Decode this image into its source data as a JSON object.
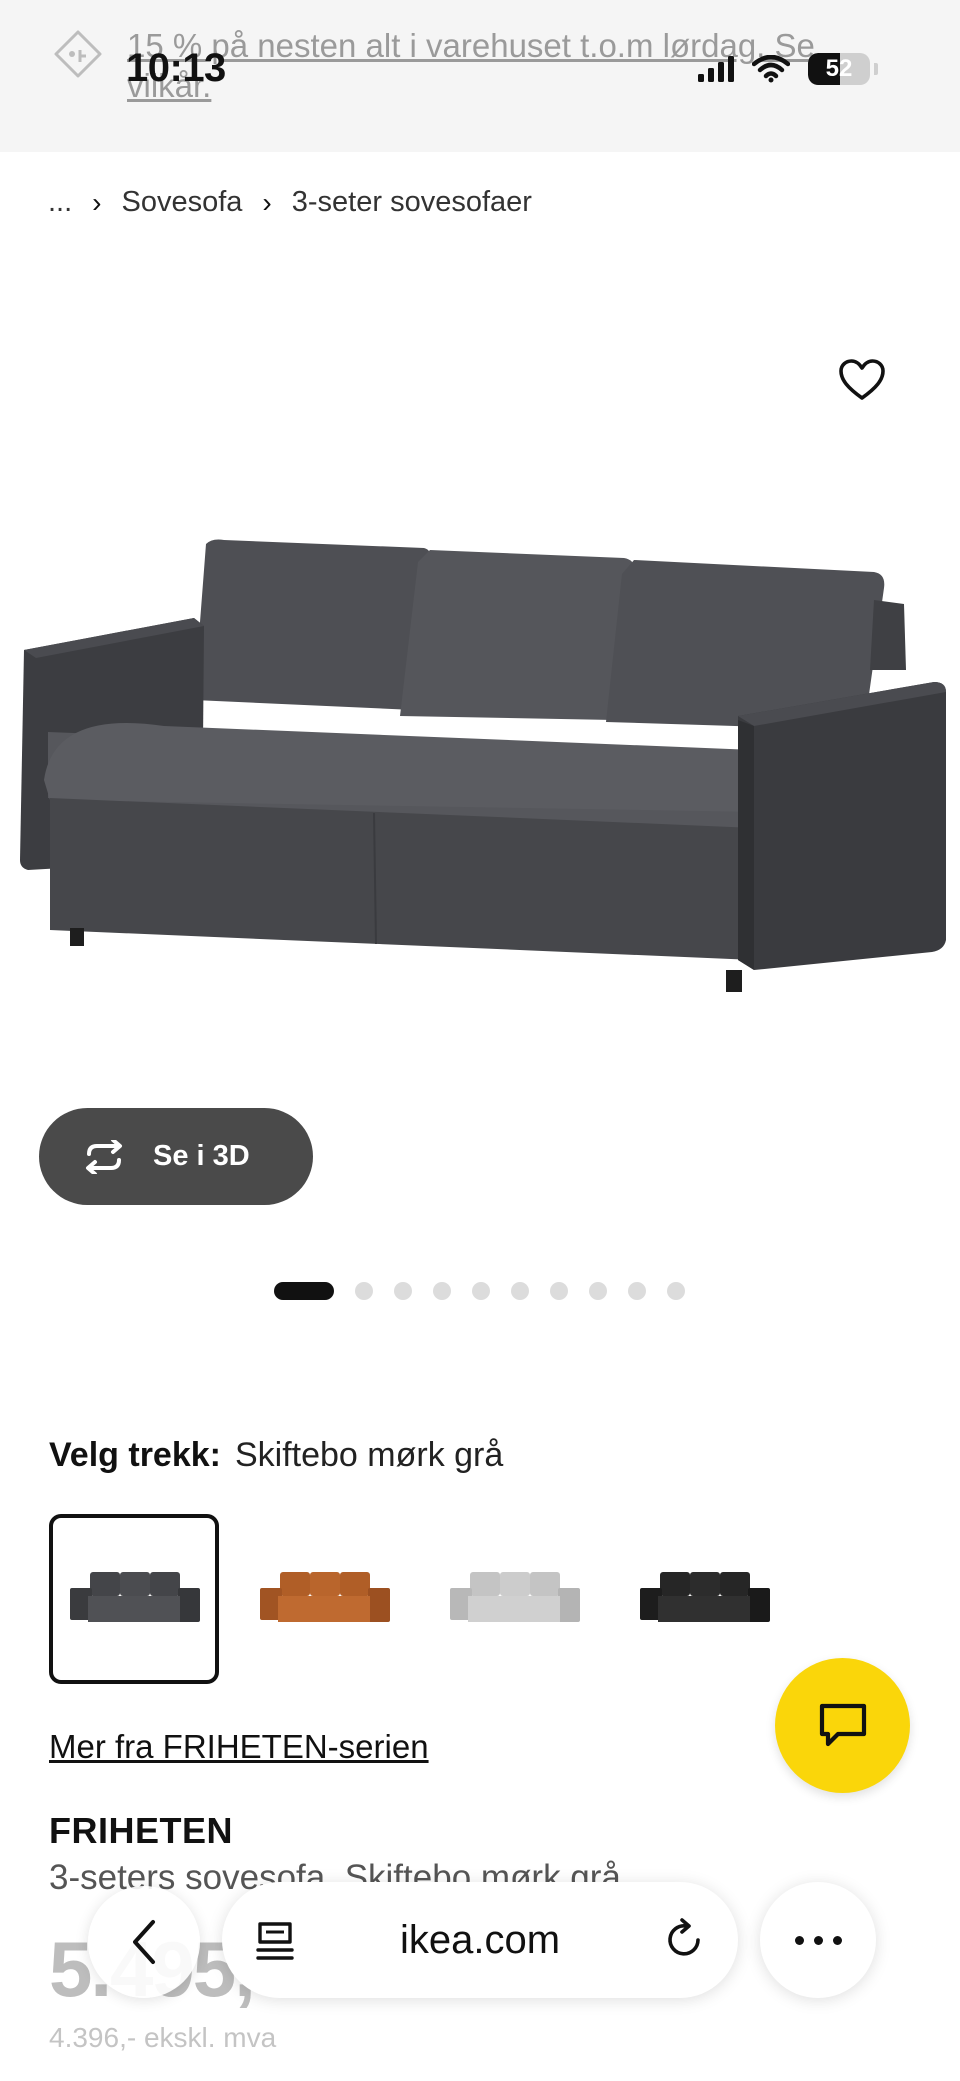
{
  "status_bar": {
    "time": "10:13",
    "battery": "52",
    "battery_level": 0.52
  },
  "promo": {
    "text": "15 % på nesten alt i varehuset t.o.m lørdag. Se vilkår."
  },
  "breadcrumb": {
    "ellipsis": "...",
    "items": [
      "Sovesofa",
      "3-seter sovesofaer"
    ]
  },
  "gallery": {
    "view3d_label": "Se i 3D",
    "dot_count": 10,
    "active_dot": 0
  },
  "cover": {
    "label": "Velg trekk:",
    "value": "Skiftebo mørk grå",
    "swatches": [
      {
        "color": "#4b4c50",
        "selected": true
      },
      {
        "color": "#b5632a",
        "selected": false
      },
      {
        "color": "#c9c9c9",
        "selected": false
      },
      {
        "color": "#2a2a2a",
        "selected": false
      }
    ]
  },
  "series_link": "Mer fra FRIHETEN-serien",
  "product": {
    "name": "FRIHETEN",
    "description": "3-seters sovesofa, Skiftebo mørk grå",
    "price": "5.495,-",
    "price_excl": "4.396,- ekskl. mva"
  },
  "toolbar": {
    "url": "ikea.com"
  },
  "colors": {
    "accent_yellow": "#fad60a",
    "sofa_dark": "#4b4c50"
  }
}
